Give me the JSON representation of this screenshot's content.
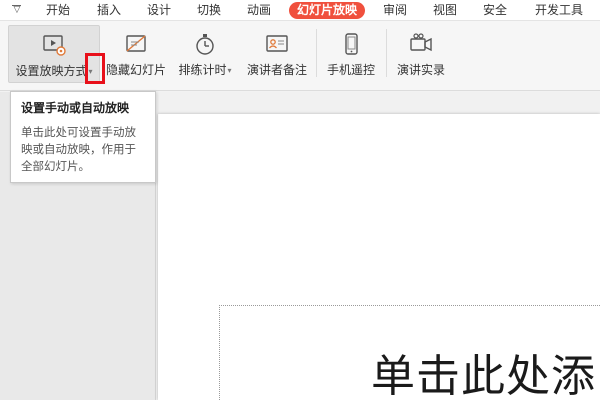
{
  "menubar": {
    "toggle_icon": "chevron-down-icon",
    "tabs": [
      {
        "label": "开始"
      },
      {
        "label": "插入"
      },
      {
        "label": "设计"
      },
      {
        "label": "切换"
      },
      {
        "label": "动画"
      },
      {
        "label": "幻灯片放映",
        "active": true
      },
      {
        "label": "审阅"
      },
      {
        "label": "视图"
      },
      {
        "label": "安全"
      },
      {
        "label": "开发工具"
      }
    ],
    "active_color": "#f0503d"
  },
  "toolbar": {
    "items": [
      {
        "label": "设置放映方式",
        "icon": "slideshow-settings-icon",
        "has_dropdown": true
      },
      {
        "label": "隐藏幻灯片",
        "icon": "hide-slide-icon"
      },
      {
        "label": "排练计时",
        "icon": "stopwatch-icon",
        "has_dropdown": true
      },
      {
        "label": "演讲者备注",
        "icon": "speaker-notes-icon"
      },
      {
        "label": "手机遥控",
        "icon": "phone-remote-icon"
      },
      {
        "label": "演讲实录",
        "icon": "video-record-icon"
      }
    ],
    "dropdown_caret": "▾"
  },
  "tooltip": {
    "title": "设置手动或自动放映",
    "body": "单击此处可设置手动放映或自动放映，作用于全部幻灯片。"
  },
  "slide": {
    "placeholder_text": "单击此处添"
  },
  "highlight_color": "#e8101a"
}
